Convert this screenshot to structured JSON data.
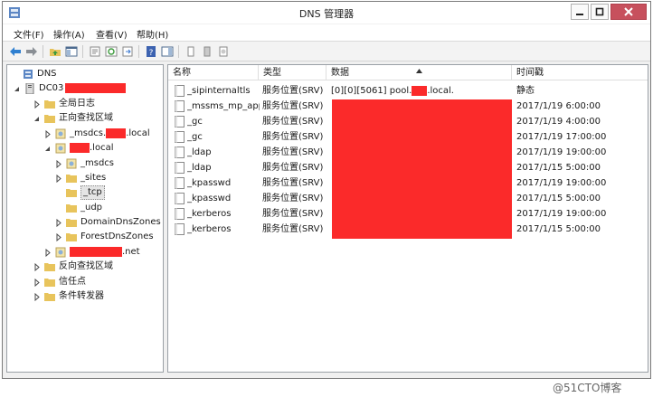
{
  "window": {
    "title": "DNS 管理器"
  },
  "menu": [
    {
      "label": "文件(F)"
    },
    {
      "label": "操作(A)"
    },
    {
      "label": "查看(V)"
    },
    {
      "label": "帮助(H)"
    }
  ],
  "toolbar": {
    "buttons": [
      {
        "icon": "back-arrow-icon"
      },
      {
        "icon": "forward-arrow-icon"
      },
      {
        "icon": "up-folder-icon"
      },
      {
        "icon": "show-hide-tree-icon"
      },
      {
        "icon": "properties-icon"
      },
      {
        "icon": "refresh-icon"
      },
      {
        "icon": "export-list-icon"
      },
      {
        "icon": "help-icon"
      },
      {
        "icon": "action-pane-icon"
      },
      {
        "icon": "record-icon"
      },
      {
        "icon": "server-icon"
      },
      {
        "icon": "zone-icon"
      }
    ]
  },
  "tree": {
    "items": [
      {
        "label": "DNS",
        "suffix": ""
      },
      {
        "label": "DC03",
        "suffix": ""
      },
      {
        "label": "全局日志",
        "suffix": ""
      },
      {
        "label": "正向查找区域",
        "suffix": ""
      },
      {
        "label": "_msdcs.",
        "suffix": ".local"
      },
      {
        "label": "",
        "suffix": ".local"
      },
      {
        "label": "_msdcs",
        "suffix": ""
      },
      {
        "label": "_sites",
        "suffix": ""
      },
      {
        "label": "_tcp",
        "suffix": ""
      },
      {
        "label": "_udp",
        "suffix": ""
      },
      {
        "label": "DomainDnsZones",
        "suffix": ""
      },
      {
        "label": "ForestDnsZones",
        "suffix": ""
      },
      {
        "label": "",
        "suffix": ".net"
      },
      {
        "label": "反向查找区域",
        "suffix": ""
      },
      {
        "label": "信任点",
        "suffix": ""
      },
      {
        "label": "条件转发器",
        "suffix": ""
      }
    ]
  },
  "list": {
    "columns": [
      {
        "label": "名称"
      },
      {
        "label": "类型"
      },
      {
        "label": "数据"
      },
      {
        "label": "时间戳"
      }
    ],
    "rows": [
      {
        "name": "_sipinternaltls",
        "type": "服务位置(SRV)",
        "data_prefix": "[0][0][5061] pool.",
        "data_suffix": ".local.",
        "timestamp": "静态"
      },
      {
        "name": "_mssms_mp_app",
        "type": "服务位置(SRV)",
        "timestamp": "2017/1/19 6:00:00"
      },
      {
        "name": "_gc",
        "type": "服务位置(SRV)",
        "timestamp": "2017/1/19 4:00:00"
      },
      {
        "name": "_gc",
        "type": "服务位置(SRV)",
        "timestamp": "2017/1/19 17:00:00"
      },
      {
        "name": "_ldap",
        "type": "服务位置(SRV)",
        "timestamp": "2017/1/19 19:00:00"
      },
      {
        "name": "_ldap",
        "type": "服务位置(SRV)",
        "timestamp": "2017/1/15 5:00:00"
      },
      {
        "name": "_kpasswd",
        "type": "服务位置(SRV)",
        "timestamp": "2017/1/19 19:00:00"
      },
      {
        "name": "_kpasswd",
        "type": "服务位置(SRV)",
        "timestamp": "2017/1/15 5:00:00"
      },
      {
        "name": "_kerberos",
        "type": "服务位置(SRV)",
        "timestamp": "2017/1/19 19:00:00"
      },
      {
        "name": "_kerberos",
        "type": "服务位置(SRV)",
        "timestamp": "2017/1/15 5:00:00"
      }
    ]
  },
  "watermark": "@51CTO博客",
  "colors": {
    "redaction": "#fb2a2a",
    "close_button": "#c7505d"
  }
}
